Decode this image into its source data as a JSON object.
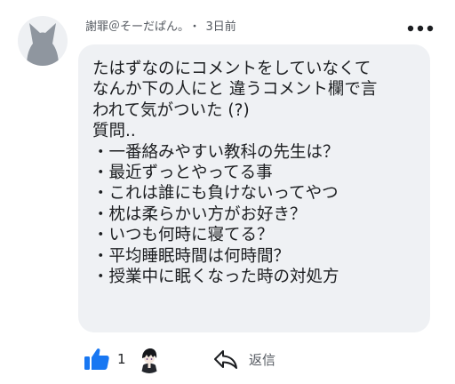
{
  "comment": {
    "author": "謝罪＠そーだぱん。",
    "separator": "・",
    "timestamp": "3日前",
    "text": "たはずなのにコメントをしていなくて\nなんか下の人にと 違うコメント欄で言\nわれて気がついた (?)\n質問..\n・一番絡みやすい教科の先生は？\n・最近ずっとやってる事\n・これは誰にも負けないってやつ\n・枕は柔らかい方がお好き？\n・いつも何時に寝てる？\n・平均睡眠時間は何時間？\n・授業中に眠くなった時の対処方"
  },
  "actions": {
    "like_count": "1",
    "reply_label": "返信"
  },
  "colors": {
    "bubble": "#eff1f4",
    "like_blue": "#1877f2",
    "secondary_text": "#555a61"
  },
  "icons": {
    "avatar": "dog-silhouette-icon",
    "more": "more-horizontal-icon",
    "like": "thumbs-up-icon",
    "reactor": "anime-character-avatar",
    "reply": "reply-arrow-icon"
  }
}
